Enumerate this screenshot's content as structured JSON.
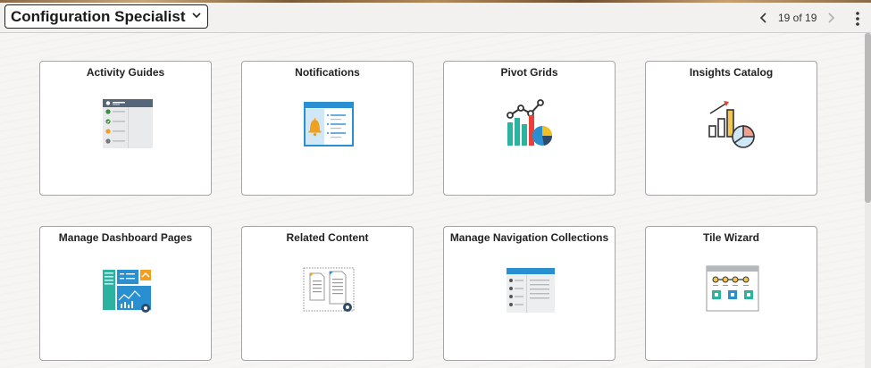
{
  "header": {
    "page_title": "Configuration Specialist",
    "pager_text": "19 of 19"
  },
  "tiles": [
    {
      "title": "Activity Guides",
      "icon": "activity-guides-icon"
    },
    {
      "title": "Notifications",
      "icon": "notifications-icon"
    },
    {
      "title": "Pivot Grids",
      "icon": "pivot-grids-icon"
    },
    {
      "title": "Insights Catalog",
      "icon": "insights-catalog-icon"
    },
    {
      "title": "Manage Dashboard Pages",
      "icon": "dashboard-pages-icon"
    },
    {
      "title": "Related Content",
      "icon": "related-content-icon"
    },
    {
      "title": "Manage Navigation Collections",
      "icon": "navigation-collections-icon"
    },
    {
      "title": "Tile Wizard",
      "icon": "tile-wizard-icon"
    }
  ],
  "colors": {
    "accent_blue": "#2a8fd0",
    "accent_orange": "#f0a020",
    "accent_teal": "#2bb3a0",
    "tile_border": "#a5a5a5"
  }
}
